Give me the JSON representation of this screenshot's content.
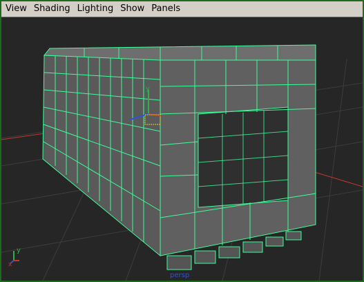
{
  "menubar": {
    "items": [
      {
        "id": "view",
        "label": "View"
      },
      {
        "id": "shading",
        "label": "Shading"
      },
      {
        "id": "lighting",
        "label": "Lighting"
      },
      {
        "id": "show",
        "label": "Show"
      },
      {
        "id": "panels",
        "label": "Panels"
      }
    ]
  },
  "viewport": {
    "camera_label": "persp",
    "axis_y_label": "y",
    "axis_x_label": "x",
    "manip_y_label": "y",
    "colors": {
      "background": "#262626",
      "grid": "#3a3a3a",
      "wire": "#3cff9a",
      "face": "#6a6a6a",
      "face_dark": "#4e4e4e",
      "x_axis": "#c03b2b",
      "y_axis": "#2fb04a",
      "z_axis": "#2f53d8",
      "selection": "#e6d21e"
    }
  }
}
